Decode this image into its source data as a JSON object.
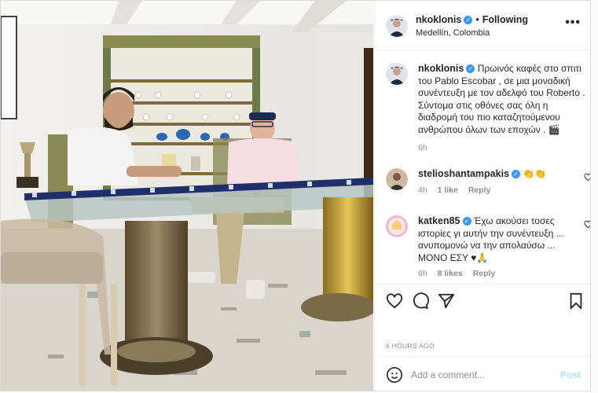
{
  "post": {
    "username": "nkoklonis",
    "follow_label": "Following",
    "location": "Medellín, Colombia",
    "more_label": "•••"
  },
  "caption": {
    "username": "nkoklonis",
    "text": "Πρωινός καφές στο σπιτι του Pablo Escobar , σε μια μοναδική συνέντευξη με τον αδελφό του Roberto . Σύντομα στις οθόνες σας όλη η διαδρομή του πιο καταζητούμενου ανθρώπου όλων των εποχών . 🎬",
    "time": "6h"
  },
  "comments": [
    {
      "username": "stelioshantampakis",
      "text": "👏👏",
      "time": "4h",
      "likes": "1 like",
      "reply": "Reply"
    },
    {
      "username": "katken85",
      "text": "Έχω ακούσει τοσες ιστορίες γι αυτήν την συνέντευξη ... ανυπομονώ να την απολαύσω ... ΜΟΝΟ ΕΣΥ ♥🙏",
      "time": "6h",
      "likes": "8 likes",
      "reply": "Reply"
    }
  ],
  "actions": {
    "timestamp": "6 HOURS AGO"
  },
  "add_comment": {
    "placeholder": "Add a comment...",
    "post_label": "Post"
  },
  "colors": {
    "verified": "#3897f0",
    "post_disabled": "#b2dffc",
    "muted": "#8e8e8e"
  },
  "icons": [
    "heart-icon",
    "comment-icon",
    "share-icon",
    "bookmark-icon",
    "emoji-icon",
    "verified-icon",
    "more-options-icon"
  ]
}
